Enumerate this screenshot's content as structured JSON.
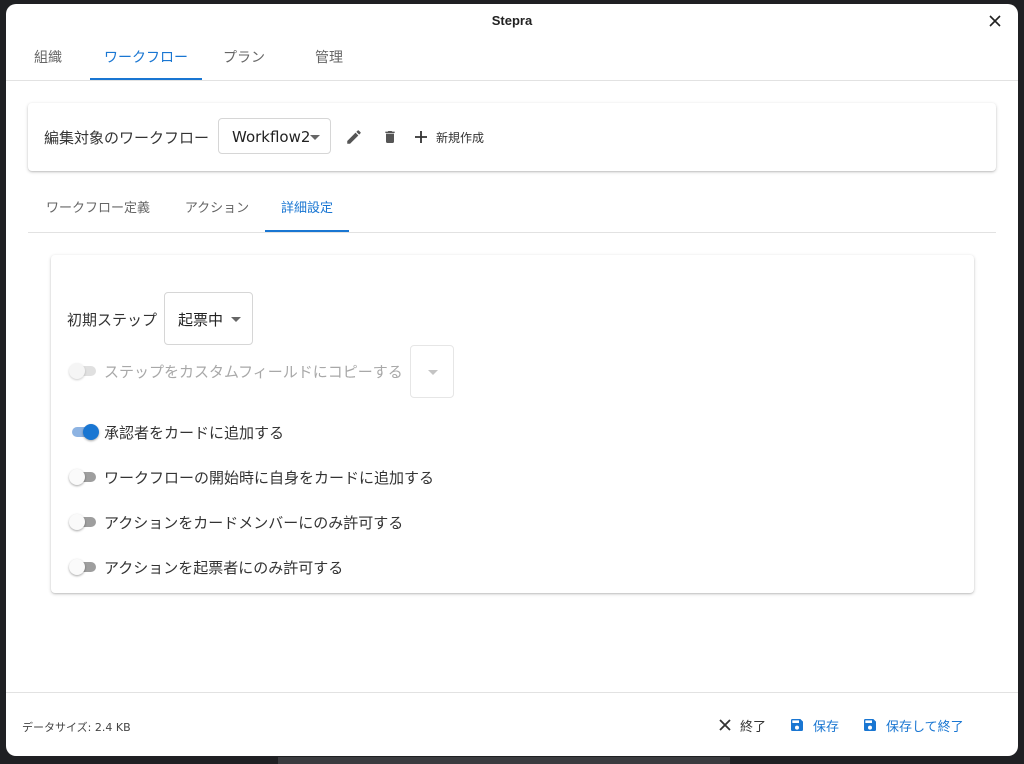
{
  "window": {
    "title": "Stepra"
  },
  "main_tabs": [
    {
      "label": "組織",
      "active": false
    },
    {
      "label": "ワークフロー",
      "active": true
    },
    {
      "label": "プラン",
      "active": false
    },
    {
      "label": "管理",
      "active": false
    }
  ],
  "workflow": {
    "label": "編集対象のワークフロー",
    "selected": "Workflow2",
    "new_label": "新規作成",
    "icons": [
      "edit-icon",
      "delete-icon",
      "plus-icon"
    ]
  },
  "sub_tabs": [
    {
      "label": "ワークフロー定義",
      "active": false
    },
    {
      "label": "アクション",
      "active": false
    },
    {
      "label": "詳細設定",
      "active": true
    }
  ],
  "settings": {
    "initial_step_label": "初期ステップ",
    "initial_step_value": "起票中",
    "copy_to_field": {
      "label": "ステップをカスタムフィールドにコピーする",
      "checked": false,
      "disabled": true,
      "value": ""
    },
    "toggles": [
      {
        "label": "承認者をカードに追加する",
        "checked": true
      },
      {
        "label": "ワークフローの開始時に自身をカードに追加する",
        "checked": false
      },
      {
        "label": "アクションをカードメンバーにのみ許可する",
        "checked": false
      },
      {
        "label": "アクションを起票者にのみ許可する",
        "checked": false
      }
    ]
  },
  "footer": {
    "data_size": "データサイズ: 2.4 KB",
    "close_label": "終了",
    "save_label": "保存",
    "save_close_label": "保存して終了"
  },
  "colors": {
    "accent": "#1976d2",
    "text": "#333333",
    "muted": "#666666"
  }
}
